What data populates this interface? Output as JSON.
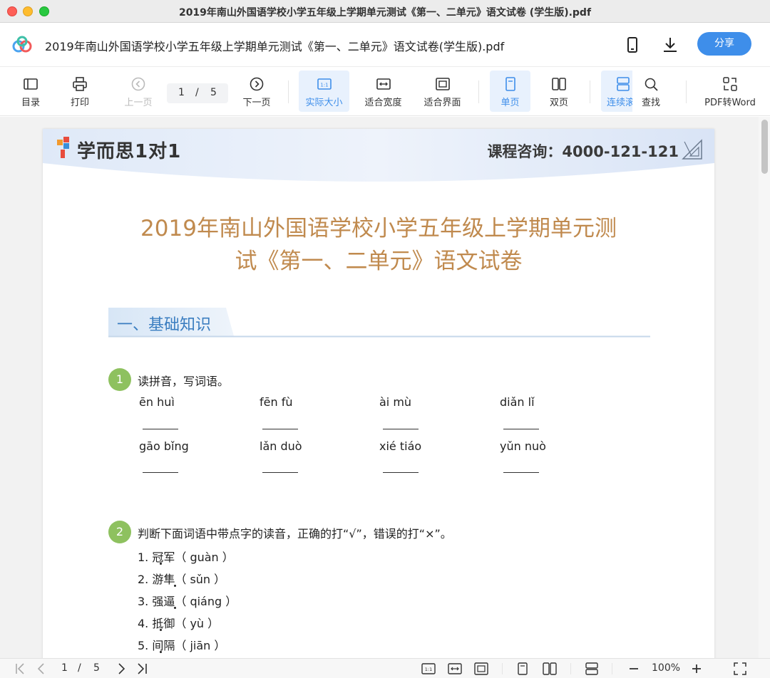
{
  "window": {
    "title": "2019年南山外国语学校小学五年级上学期单元测试《第一、二单元》语文试卷 (学生版).pdf"
  },
  "header": {
    "doc_title": "2019年南山外国语学校小学五年级上学期单元测试《第一、二单元》语文试卷(学生版).pdf",
    "share_label": "分享"
  },
  "toolbar": {
    "toc": "目录",
    "print": "打印",
    "prev": "上一页",
    "page_current": "1",
    "page_sep": "/",
    "page_total": "5",
    "next": "下一页",
    "actual_size": "实际大小",
    "fit_width": "适合宽度",
    "fit_page": "适合界面",
    "single": "单页",
    "double": "双页",
    "continuous": "连续滚",
    "find": "查找",
    "pdf2word": "PDF转Word"
  },
  "document": {
    "brand": "学而思1对1",
    "consult": "课程咨询：4000-121-121",
    "title_line1": "2019年南山外国语学校小学五年级上学期单元测",
    "title_line2": "试《第一、二单元》语文试卷",
    "section1": "一、基础知识",
    "q1": {
      "num": "1",
      "text": "读拼音，写词语。",
      "pinyin": [
        "ēn  huì",
        "fēn  fù",
        "ài  mù",
        "diǎn  lǐ",
        "gāo  bǐng",
        "lǎn  duò",
        "xié  tiáo",
        "yǔn  nuò"
      ]
    },
    "q2": {
      "num": "2",
      "text": "判断下面词语中带点字的读音，正确的打“√”，错误的打“×”。",
      "items": [
        "1.  冠军（  guàn  ）",
        "2.  游隼（  sǔn   ）",
        "3.  强逼（  qiáng  ）",
        "4.  抵御（  yù  ）",
        "5.  间隔（  jiān   ）"
      ]
    }
  },
  "statusbar": {
    "page_current": "1",
    "page_sep": "/",
    "page_total": "5",
    "zoom": "100%"
  }
}
